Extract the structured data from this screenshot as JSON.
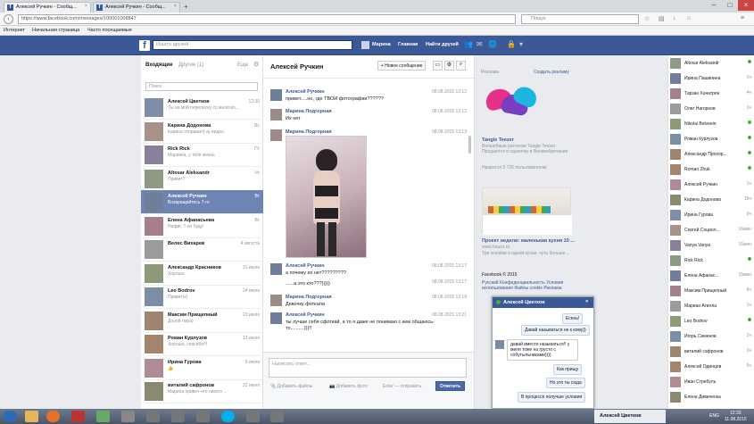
{
  "browser": {
    "tabs": [
      {
        "title": "Алексей Ручкин - Сообщ..."
      },
      {
        "title": "Алексей Ручкин - Сообщ..."
      }
    ],
    "url": "https://www.facebook.com/messages/100001008847",
    "search_placeholder": "Пошук",
    "bookmarks": [
      "Интернет",
      "Начальная страница",
      "Часто посещаемые"
    ]
  },
  "fb_header": {
    "logo": "f",
    "search_placeholder": "Ищите друзей",
    "user": "Марина",
    "nav": [
      "Главная",
      "Найти друзей"
    ]
  },
  "conversations_header": {
    "inbox": "Входящие",
    "other": "Другие (1)",
    "more": "Еще",
    "search_placeholder": "Поиск"
  },
  "conversations": [
    {
      "name": "Алексей Цветков",
      "preview": "Ты на мой переписку со мной во...",
      "time": "12:30"
    },
    {
      "name": "Карина Додонова",
      "preview": "Карина отправил(-а) видео.",
      "time": "Вс"
    },
    {
      "name": "Rick Rick",
      "preview": "Маринка, у тебя жизнь",
      "time": "Пт"
    },
    {
      "name": "Altosar Aleksandr",
      "preview": "Привет?",
      "time": "Чт"
    },
    {
      "name": "Алексей Ручкин",
      "preview": "Возвращайтесь 7-го",
      "time": "Вт"
    },
    {
      "name": "Елена Афанасьева",
      "preview": "Нафиг, 7-но буду!",
      "time": "Вт"
    },
    {
      "name": "Велес Вихарев",
      "preview": "",
      "time": "4 августа"
    },
    {
      "name": "Александр Красников",
      "preview": "Хорошо",
      "time": "31 июля"
    },
    {
      "name": "Leo Bodrov",
      "preview": "Привет(к)",
      "time": "24 июля"
    },
    {
      "name": "Максим Прищепный",
      "preview": "Доной пора)",
      "time": "23 июля"
    },
    {
      "name": "Роман Курлузов",
      "preview": "Хорошо, спасибо!!!",
      "time": "13 июля"
    },
    {
      "name": "Ирина Гурова",
      "preview": "👍",
      "time": "9 июля"
    },
    {
      "name": "виталий сафронов",
      "preview": "Марина привет-что никого ...",
      "time": "22 июня"
    }
  ],
  "thread": {
    "title": "Алексей Ручкин",
    "new_message": "+ Новое сообщение",
    "messages": [
      {
        "author": "Алексей Ручкин",
        "date": "08.08.2015 13:12",
        "text": "привет.....но, где ТВОИ фотографии??????"
      },
      {
        "author": "Марина Подгорная",
        "date": "08.08.2015 13:12",
        "text": "Их нет"
      },
      {
        "author": "Марина Подгорная",
        "date": "08.08.2015 13:13",
        "text": ""
      },
      {
        "author": "Алексей Ручкин",
        "date": "08.08.2015 13:17",
        "text": "а почему их нет?????????"
      },
      {
        "author": "",
        "date": "08.08.2015 13:17",
        "text": "......а это кто???)))))"
      },
      {
        "author": "Марина Подгорная",
        "date": "08.08.2015 13:19",
        "text": "Девочку фоткала"
      },
      {
        "author": "Алексей Ручкин",
        "date": "08.08.2015 13:21",
        "text": "ты лучше себя сфоткай, а то я даже не понимаю с кем общаюсь-то..........)))!!"
      }
    ],
    "composer_placeholder": "Написать ответ...",
    "add_files": "Добавить файлы",
    "add_photo": "Добавить фото",
    "enter_hint": "Enter — отправить",
    "reply_button": "Ответить"
  },
  "ads": {
    "header": "Реклама",
    "create": "Создать рекламу",
    "ad1": {
      "title": "Tangle Teezer",
      "text": "Волшебные расчески Tangle Teezer. Продаются в одиночку в Великобритании",
      "likes": "Нравится 5 726 пользователям"
    },
    "ad2": {
      "title": "Проект недели: маленькая кухня 10 ...",
      "site": "www.houzz.ru",
      "text": "Три хозяйки и одной кухни, чуть больше..."
    },
    "footer": "Facebook © 2015",
    "footer_links": [
      "Русский",
      "Конфиденциальность",
      "Условия использования",
      "Файлы cookie",
      "Реклама"
    ]
  },
  "contacts": [
    {
      "name": "Altosar Aleksandr",
      "status": "online"
    },
    {
      "name": "Ирина Пашинина",
      "status": "1ч"
    },
    {
      "name": "Тарзан Хачатрян",
      "status": "4ч"
    },
    {
      "name": "Олег Нагорнов",
      "status": "1ч"
    },
    {
      "name": "Nikolai Belveein",
      "status": "online"
    },
    {
      "name": "Роман Курлузов",
      "status": "online"
    },
    {
      "name": "Александр Прохор...",
      "status": "online"
    },
    {
      "name": "Roman Zhuk",
      "status": "online"
    },
    {
      "name": "Алексей Ручкин",
      "status": "1ч"
    },
    {
      "name": "Карина Додонова",
      "status": "15ч"
    },
    {
      "name": "Ирина Гурова",
      "status": "6ч"
    },
    {
      "name": "Сергей Социол...",
      "status": "16мин"
    },
    {
      "name": "Vanya Vanya",
      "status": "16мин"
    },
    {
      "name": "Rick Rick",
      "status": "online"
    },
    {
      "name": "Елена Афанас...",
      "status": "15мин"
    },
    {
      "name": "Максим Прищепный",
      "status": "6ч"
    },
    {
      "name": "Мариан Агилла",
      "status": "1ч"
    },
    {
      "name": "Leo Bodrov",
      "status": "online"
    },
    {
      "name": "Игорь Семенов",
      "status": "1ч"
    },
    {
      "name": "виталий сафронов",
      "status": "1ч"
    },
    {
      "name": "Алексей Одинцов",
      "status": "6ч"
    },
    {
      "name": "Иван Стребуль",
      "status": ""
    },
    {
      "name": "Елена Дивиченка",
      "status": ""
    }
  ],
  "chat": {
    "title": "Алексей Цветков",
    "bubbles": [
      {
        "text": "Есень!",
        "side": "r"
      },
      {
        "text": "Давай называться не к кому))",
        "side": "r"
      },
      {
        "text": "давай вместе называться!! у меня тоже на грусто с собутыльниками))))",
        "side": "l"
      },
      {
        "text": "Как прищу",
        "side": "r"
      },
      {
        "text": "Но это ты сюда",
        "side": "r"
      },
      {
        "text": "В процессе получше условия",
        "side": "r"
      }
    ]
  },
  "taskbar": {
    "active_chat": "Алексей Цветков",
    "lang": "ENG",
    "time": "12:33",
    "date": "11.08.2015"
  }
}
